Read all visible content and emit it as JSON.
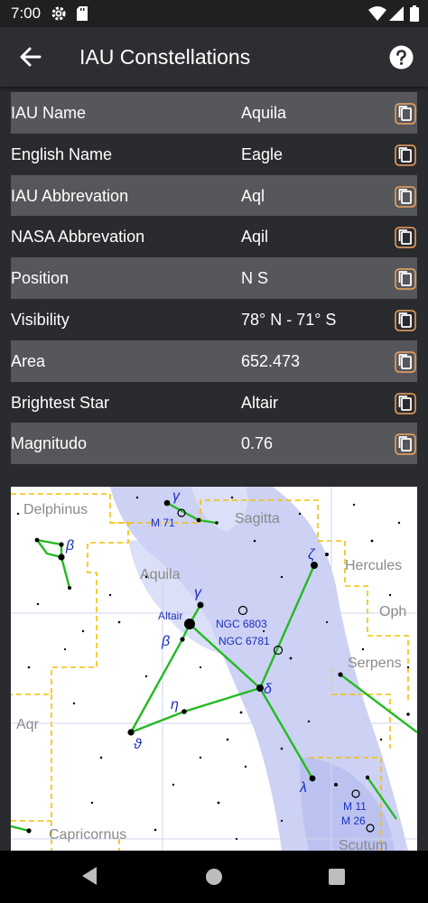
{
  "status_bar": {
    "time": "7:00"
  },
  "app_bar": {
    "title": "IAU Constellations"
  },
  "rows": [
    {
      "label": "IAU Name",
      "value": "Aquila"
    },
    {
      "label": "English Name",
      "value": "Eagle"
    },
    {
      "label": "IAU Abbrevation",
      "value": "Aql"
    },
    {
      "label": "NASA Abbrevation",
      "value": "Aqil"
    },
    {
      "label": "Position",
      "value": "N S"
    },
    {
      "label": "Visibility",
      "value": "78° N - 71° S"
    },
    {
      "label": "Area",
      "value": "652.473"
    },
    {
      "label": "Brightest Star",
      "value": "Altair"
    },
    {
      "label": "Magnitudo",
      "value": "0.76"
    }
  ],
  "star_chart": {
    "constellation_labels": {
      "delphinus": "Delphinus",
      "sagitta": "Sagitta",
      "aquila": "Aquila",
      "hercules": "Hercules",
      "ophiuchus": "Oph",
      "serpens": "Serpens",
      "aquarius": "Aqr",
      "capricornus": "Capricornus",
      "scutum": "Scutum"
    },
    "object_labels": {
      "altair": "Altair",
      "ngc6803": "NGC 6803",
      "ngc6781": "NGC 6781",
      "m71": "M 71",
      "m11": "M 11",
      "m26": "M 26"
    },
    "greek_labels": {
      "gamma_sge": "γ",
      "beta_del": "β",
      "gamma_aql": "γ",
      "beta_aql": "β",
      "zeta_aql": "ζ",
      "eta_aql": "η",
      "delta_aql": "δ",
      "theta_aql": "ϑ",
      "lambda_aql": "λ"
    },
    "colors": {
      "milky_way": "#c8cdf3",
      "boundary": "#f2c100",
      "figure_line": "#22bb22",
      "label_blue": "#1a2fbf",
      "label_gray": "#8a8a8a"
    }
  },
  "nav_bar": {
    "back": "back-triangle",
    "home": "home-circle",
    "recents": "recents-square"
  }
}
